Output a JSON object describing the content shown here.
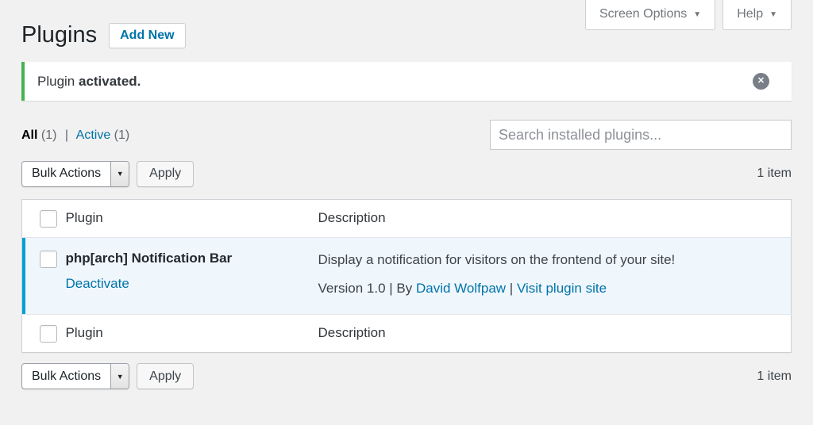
{
  "screen_meta": {
    "screen_options_label": "Screen Options",
    "help_label": "Help",
    "caret": "▼"
  },
  "header": {
    "title": "Plugins",
    "add_new_label": "Add New"
  },
  "notice": {
    "text_regular": "Plugin ",
    "text_bold": "activated.",
    "dismiss_glyph": "✕"
  },
  "filters": {
    "all_label": "All",
    "all_count": "(1)",
    "separator": "|",
    "active_label": "Active",
    "active_count": "(1)"
  },
  "search": {
    "placeholder": "Search installed plugins..."
  },
  "tablenav_top": {
    "bulk_actions_value": "Bulk Actions",
    "select_caret": "▼",
    "apply_label": "Apply",
    "item_count": "1 item"
  },
  "tablenav_bottom": {
    "bulk_actions_value": "Bulk Actions",
    "select_caret": "▼",
    "apply_label": "Apply",
    "item_count": "1 item"
  },
  "table": {
    "columns": {
      "plugin": "Plugin",
      "description": "Description"
    },
    "rows": [
      {
        "name": "php[arch] Notification Bar",
        "action_label": "Deactivate",
        "description": "Display a notification for visitors on the frontend of your site!",
        "meta_prefix": "Version 1.0 | By ",
        "author_link": "David Wolfpaw",
        "meta_separator": " | ",
        "plugin_site_link": "Visit plugin site"
      }
    ]
  },
  "colors": {
    "accent_blue": "#0073aa",
    "active_row_border": "#00a0d2",
    "notice_green": "#46b450",
    "page_background": "#f1f1f1"
  }
}
